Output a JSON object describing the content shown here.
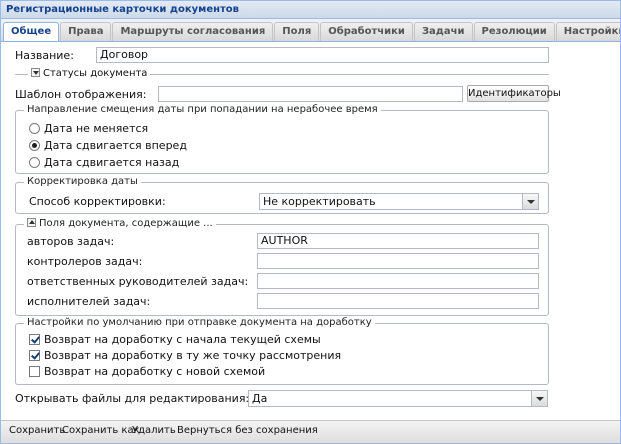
{
  "window": {
    "title": "Регистрационные карточки документов"
  },
  "tabs": [
    {
      "label": "Общее",
      "active": true
    },
    {
      "label": "Права"
    },
    {
      "label": "Маршруты согласования"
    },
    {
      "label": "Поля"
    },
    {
      "label": "Обработчики"
    },
    {
      "label": "Задачи"
    },
    {
      "label": "Резолюции"
    },
    {
      "label": "Настройки почтовых уведомлений"
    }
  ],
  "form": {
    "name_label": "Название:",
    "name_value": "Договор",
    "statuses_legend": "Статусы документа",
    "template_label": "Шаблон отображения:",
    "template_value": "",
    "identifiers_button": "Идентификаторы",
    "date_shift": {
      "legend": "Направление смещения даты при попадании на нерабочее время",
      "options": [
        "Дата не меняется",
        "Дата сдвигается вперед",
        "Дата сдвигается назад"
      ],
      "selected_index": 1
    },
    "date_correction": {
      "legend": "Корректировка даты",
      "method_label": "Способ корректировки:",
      "method_value": "Не корректировать"
    },
    "doc_fields": {
      "legend": "Поля документа, содержащие ...",
      "rows": [
        {
          "label": "авторов задач:",
          "value": "AUTHOR"
        },
        {
          "label": "контролеров задач:",
          "value": ""
        },
        {
          "label": "ответственных руководителей задач:",
          "value": ""
        },
        {
          "label": "исполнителей задач:",
          "value": ""
        }
      ]
    },
    "rework": {
      "legend": "Настройки по умолчанию при отправке документа на доработку",
      "options": [
        {
          "label": "Возврат на доработку с начала текущей схемы",
          "checked": true
        },
        {
          "label": "Возврат на доработку в ту же точку рассмотрения",
          "checked": true
        },
        {
          "label": "Возврат на доработку с новой схемой",
          "checked": false
        }
      ]
    },
    "open_files_label": "Открывать файлы для редактирования:",
    "open_files_value": "Да"
  },
  "footer": {
    "save": "Сохранить",
    "save_as": "Сохранить как",
    "delete": "Удалить",
    "back": "Вернуться без сохранения"
  }
}
